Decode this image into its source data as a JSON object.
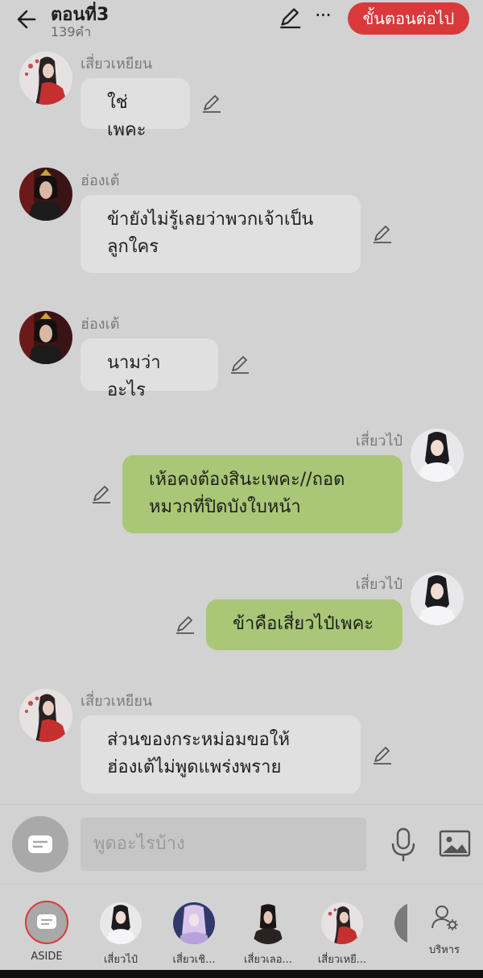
{
  "header": {
    "title": "ตอนที่3",
    "word_count": "139คำ",
    "next_button": "ขั้นตอนต่อไป",
    "more_label": "···"
  },
  "messages": [
    {
      "side": "left",
      "speaker": "เสี่ยวเหยียน",
      "text": "ใช่เพคะ"
    },
    {
      "side": "left",
      "speaker": "ฮ่องเต้",
      "text": "ข้ายังไม่รู้เลยว่าพวกเจ้าเป็น ลูกใคร"
    },
    {
      "side": "left",
      "speaker": "ฮ่องเต้",
      "text": "นามว่าอะไร"
    },
    {
      "side": "right",
      "speaker": "เสี่ยวไป๋",
      "text": "เห้อคงต้องสินะเพคะ//ถอด หมวกที่ปิดบังใบหน้า"
    },
    {
      "side": "right",
      "speaker": "เสี่ยวไป๋",
      "text": "ข้าคือเสี่ยวไป๋เพคะ"
    },
    {
      "side": "left",
      "speaker": "เสี่ยวเหยียน",
      "text": "ส่วนของกระหม่อมขอให้ ฮ่องเต้ไม่พูดแพร่งพราย"
    }
  ],
  "input": {
    "placeholder": "พูดอะไรบ้าง"
  },
  "cast": [
    {
      "label": "ASIDE"
    },
    {
      "label": "เสี่ยวไป๋"
    },
    {
      "label": "เสี่ยวเชิ..."
    },
    {
      "label": "เสี่ยวเลอ..."
    },
    {
      "label": "เสี่ยวเหยี..."
    },
    {
      "label": "บริหาร"
    }
  ],
  "colors": {
    "accent_red": "#d9393b",
    "bubble_right": "#a9c776",
    "bubble_left": "#e0e0e0",
    "background": "#d2d2d2"
  }
}
